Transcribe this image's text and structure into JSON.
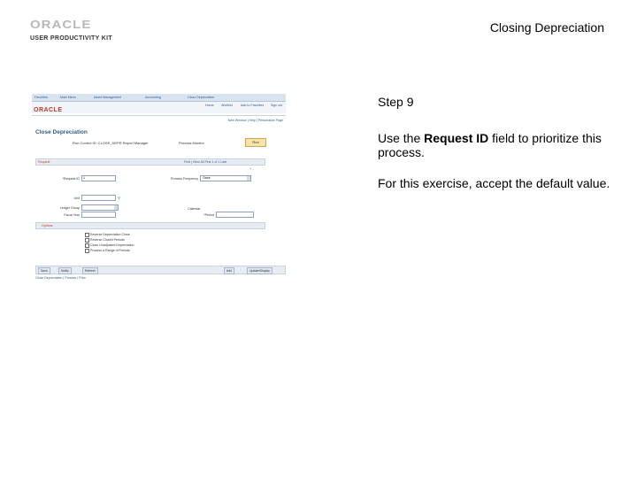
{
  "slide": {
    "logo_main": "ORACLE",
    "logo_sub": "USER PRODUCTIVITY KIT",
    "title": "Closing Depreciation"
  },
  "screenshot": {
    "nav_items": [
      "Favorites",
      "Main Menu",
      "Asset Management",
      "Accounting",
      "Close Depreciation"
    ],
    "brand": "ORACLE",
    "header_links": [
      "Home",
      "Worklist",
      "Add to Favorites",
      "Sign out"
    ],
    "new_window": "New Window | Help | Personalize Page",
    "page_title": "Close Depreciation",
    "run_control_line": "Run Control ID: CLOSE_DEPR  Report Manager",
    "process_monitor": "Process Monitor",
    "run_button": "Run",
    "section1": "Request",
    "pager": "Find | View All   First 1 of 1 Last",
    "plusminus": "+ -",
    "fields": {
      "request_id_label": "*Request ID",
      "request_id_value": "1",
      "process_frequency_label": "Process Frequency",
      "process_frequency_value": "Once",
      "unit_label": "Unit",
      "ledger_group_label": "Ledger Group",
      "fiscal_year_label": "Fiscal Year",
      "calendar_label": "Calendar",
      "period_label": "*Period"
    },
    "section2": "Options",
    "options": [
      "Reverse Depreciation Close",
      "Reverse Closed Periods",
      "Close Unadjusted Depreciation",
      "Process a Range of Periods"
    ],
    "buttons": [
      "Save",
      "Notify",
      "Refresh",
      "Add",
      "Update/Display"
    ],
    "footer": "Close Depreciation | Process | Prior"
  },
  "instructions": {
    "step": "Step 9",
    "p1_pre": "Use the ",
    "p1_bold": "Request ID",
    "p1_post": " field to prioritize this process.",
    "p2": "For this exercise, accept the default value."
  }
}
